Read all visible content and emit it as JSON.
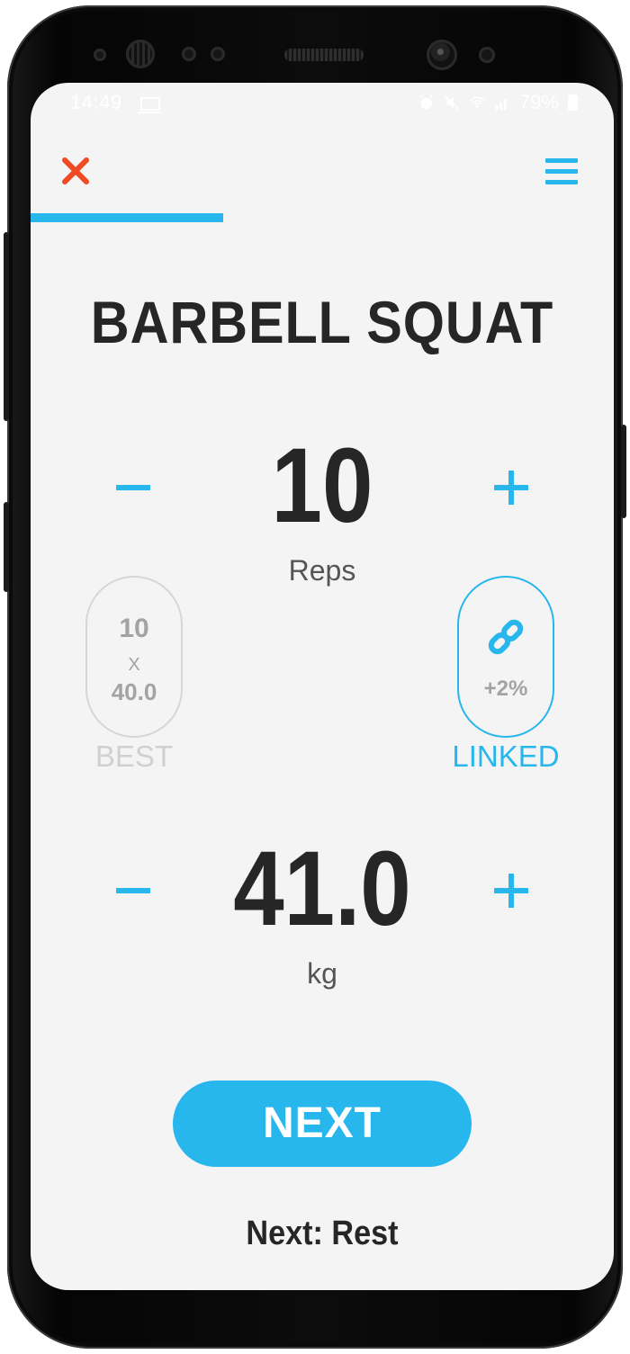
{
  "status_bar": {
    "time": "14:49",
    "battery": "79%"
  },
  "header": {
    "progress_fraction": 0.33
  },
  "exercise": {
    "title": "BARBELL SQUAT"
  },
  "reps": {
    "value": "10",
    "label": "Reps",
    "minus_symbol": "–",
    "plus_symbol": "+"
  },
  "best": {
    "reps": "10",
    "times_symbol": "X",
    "weight": "40.0",
    "label": "BEST"
  },
  "linked": {
    "increment": "+2%",
    "label": "LINKED"
  },
  "weight": {
    "value": "41.0",
    "unit": "kg",
    "minus_symbol": "–",
    "plus_symbol": "+"
  },
  "actions": {
    "next_button_label": "NEXT",
    "next_up_text": "Next: Rest"
  },
  "colors": {
    "accent": "#27b7ec",
    "close": "#f04a23",
    "text_dark": "#262626",
    "muted": "#a3a3a3",
    "background": "#f4f4f4"
  },
  "icons": {
    "close": "close-icon",
    "menu": "hamburger-menu-icon",
    "link": "chain-link-icon"
  }
}
